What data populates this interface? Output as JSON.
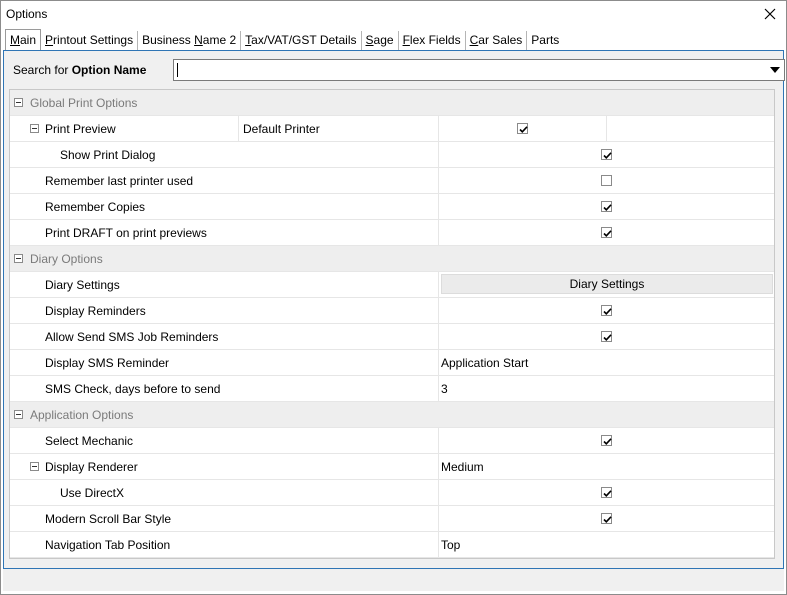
{
  "window": {
    "title": "Options"
  },
  "tabs": [
    {
      "label_pre": "",
      "label_u": "M",
      "label_post": "ain",
      "active": true
    },
    {
      "label_pre": "",
      "label_u": "P",
      "label_post": "rintout Settings",
      "active": false
    },
    {
      "label_pre": "Business ",
      "label_u": "N",
      "label_post": "ame 2",
      "active": false
    },
    {
      "label_pre": "",
      "label_u": "T",
      "label_post": "ax/VAT/GST Details",
      "active": false
    },
    {
      "label_pre": "",
      "label_u": "S",
      "label_post": "age",
      "active": false
    },
    {
      "label_pre": "",
      "label_u": "F",
      "label_post": "lex Fields",
      "active": false
    },
    {
      "label_pre": "",
      "label_u": "C",
      "label_post": "ar Sales",
      "active": false
    },
    {
      "label_pre": "",
      "label_u": "",
      "label_post": "Parts",
      "active": false
    }
  ],
  "search": {
    "label_prefix": "Search for ",
    "label_bold": "Option Name",
    "value": ""
  },
  "groups": {
    "global": "Global Print Options",
    "diary": "Diary Options",
    "application": "Application Options"
  },
  "rows": {
    "print_preview": {
      "label": "Print Preview",
      "mid": "Default Printer",
      "checked": true
    },
    "show_print_dialog": {
      "label": "Show Print Dialog",
      "checked": true
    },
    "remember_last_printer": {
      "label": "Remember last printer used",
      "checked": false
    },
    "remember_copies": {
      "label": "Remember Copies",
      "checked": true
    },
    "print_draft": {
      "label": "Print DRAFT on print previews",
      "checked": true
    },
    "diary_settings": {
      "label": "Diary Settings",
      "button": "Diary Settings"
    },
    "display_reminders": {
      "label": "Display Reminders",
      "checked": true
    },
    "allow_sms": {
      "label": "Allow Send SMS Job Reminders",
      "checked": true
    },
    "display_sms_reminder": {
      "label": "Display SMS Reminder",
      "value": "Application Start"
    },
    "sms_check_days": {
      "label": "SMS Check, days before to send",
      "value": "3"
    },
    "select_mechanic": {
      "label": "Select Mechanic",
      "checked": true
    },
    "display_renderer": {
      "label": "Display Renderer",
      "value": "Medium"
    },
    "use_directx": {
      "label": "Use DirectX",
      "checked": true
    },
    "modern_scroll": {
      "label": "Modern Scroll Bar Style",
      "checked": true
    },
    "nav_tab_position": {
      "label": "Navigation Tab Position",
      "value": "Top"
    }
  },
  "colors": {
    "panel_border": "#2f75b5",
    "group_bg": "#eeeeee",
    "group_text": "#7a7a7a"
  },
  "icons": {
    "close": "close-icon",
    "dropdown": "chevron-down-icon",
    "expander": "collapse-icon",
    "check": "checkmark-icon"
  }
}
